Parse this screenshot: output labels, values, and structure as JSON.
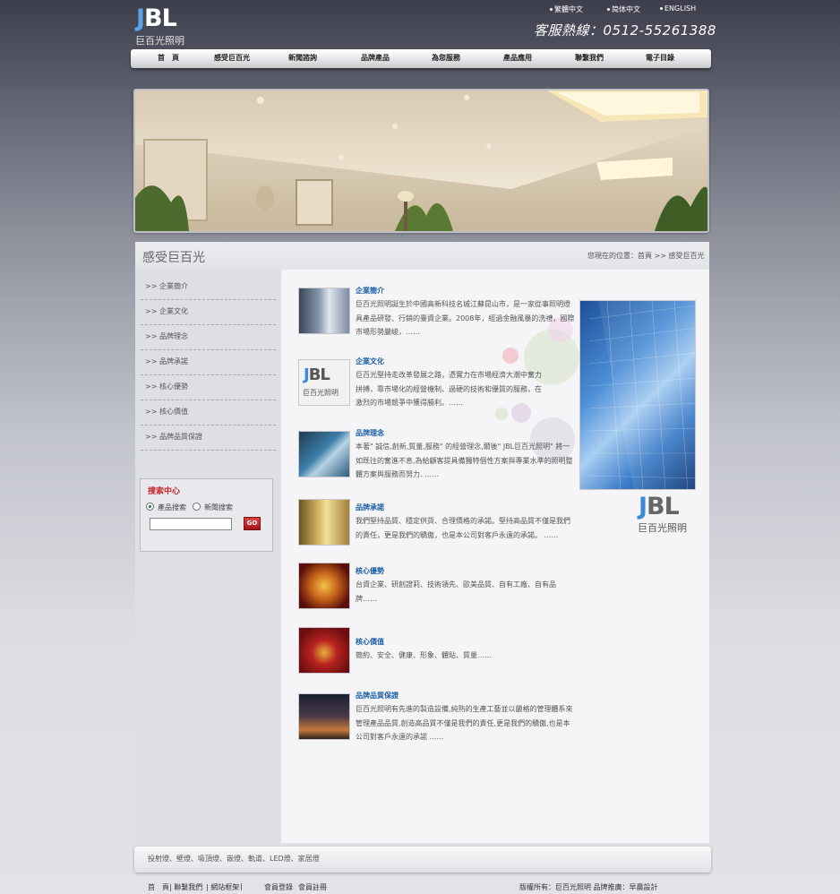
{
  "header": {
    "logo_mark": "JBL",
    "logo_mark_tail": "BL",
    "logo_text": "巨百光照明",
    "languages": [
      "繁體中文",
      "简体中文",
      "ENGLISH"
    ],
    "hotline": "客服熱線：0512-55261388"
  },
  "nav": [
    "首　頁",
    "感受巨百光",
    "新聞諮詢",
    "品牌產品",
    "為您服務",
    "產品應用",
    "聯繫我們",
    "電子目錄"
  ],
  "page": {
    "title": "感受巨百光",
    "breadcrumb": "您現在的位置：首頁  >> 感受巨百光"
  },
  "sidebar": {
    "items": [
      ">> 企業簡介",
      ">> 企業文化",
      ">> 品牌理念",
      ">> 品牌承諾",
      ">> 核心優勢",
      ">> 核心價值",
      ">> 品牌品質保證"
    ]
  },
  "search": {
    "title": "搜索中心",
    "option_product": "產品搜索",
    "option_news": "新聞搜索",
    "input_value": "",
    "go_label": "GO"
  },
  "articles": [
    {
      "title": "企業簡介",
      "body": "巨百光照明誕生於中國高新科技名城江蘇昆山市，是一家從事照明燈具產品研發、行銷的臺資企業。2008年，經過金融風暴的洗禮，國際市場形勢嚴峻，……"
    },
    {
      "title": "企業文化",
      "body": "巨百光堅持走改革發展之路，憑實力在市場經濟大潮中奮力拼搏，靠市場化的經營機制、過硬的技術和優質的服務，在激烈的市場競爭中獲得勝利。……"
    },
    {
      "title": "品牌理念",
      "body": "本著\" 誠信,創新,質量,服務\" 的經營理念,爾後\" JBL巨百光照明\" 將一如既往的奮進不息,為給顧客提具備獨特個性方案與專業水準的照明整體方案與服務而努力. ……"
    },
    {
      "title": "品牌承諾",
      "body": "我們堅持品質、穩定供貨、合理價格的承諾。堅持高品質不僅是我們的責任，更是我們的驕傲，也是本公司對客戶永遠的承諾。 ……"
    },
    {
      "title": "核心優勢",
      "body": "台資企業、研創證莉、技術領先、歐美品質、自有工廠、自有品牌……"
    },
    {
      "title": "核心價值",
      "body": "簡約、安全、健康、形象、體貼、質量……"
    },
    {
      "title": "品牌品質保證",
      "body": "巨百光照明有先進的製造設備,純熟的生產工藝並以嚴格的管理體系來管理產品品質,創造高品質不僅是我們的責任,更是我們的驕傲,也是本公司對客戶永遠的承諾 ……"
    }
  ],
  "side_logo": {
    "mark": "JBL",
    "mark_tail": "BL",
    "text": "巨百光照明"
  },
  "footer": {
    "categories": "投射燈、壁燈、吸頂燈、嵌燈、軌道、LED燈、家居燈",
    "links": [
      "首　頁",
      "|  聯繫我們",
      "|  網站框架",
      "|",
      "會員登錄",
      "會員註冊"
    ],
    "copyright": "版權所有：巨百光照明  品牌推廣：早晨設計"
  }
}
